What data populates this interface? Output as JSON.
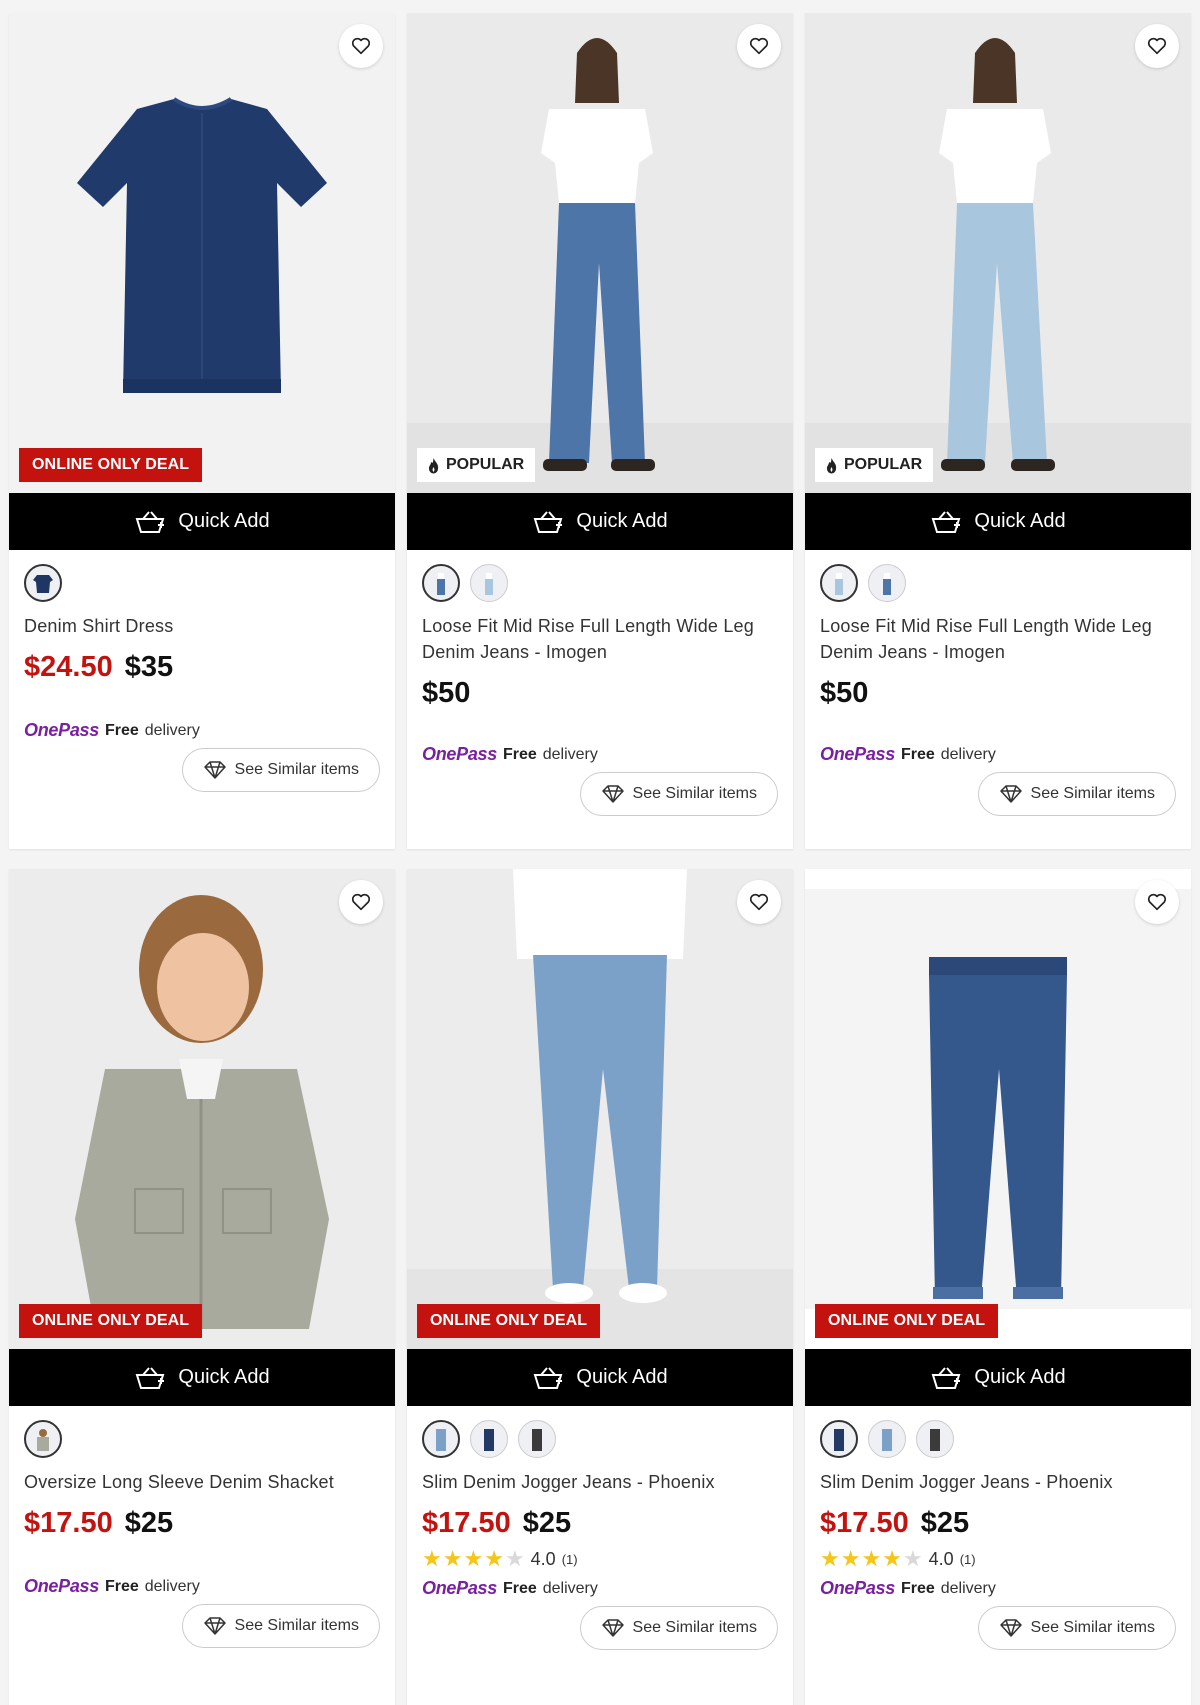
{
  "colors": {
    "accent_red": "#c4120f",
    "onepass_purple": "#7a1fa2",
    "star": "#f5c518",
    "quick_add_bg": "#000000"
  },
  "common": {
    "quick_add": "Quick Add",
    "see_similar": "See Similar items",
    "onepass_logo": "OnePass",
    "free": "Free",
    "delivery": "delivery"
  },
  "products": [
    {
      "name": "Denim Shirt Dress",
      "sale": "$24.50",
      "orig": "$35",
      "badge": "ONLINE ONLY DEAL",
      "badge_type": "deal",
      "swatches": 1,
      "image": "denim-dress"
    },
    {
      "name": "Loose Fit Mid Rise Full Length Wide Leg Denim Jeans - Imogen",
      "sale": "",
      "orig": "$50",
      "badge": "POPULAR",
      "badge_type": "popular",
      "swatches": 2,
      "image": "woman-mid-jeans"
    },
    {
      "name": "Loose Fit Mid Rise Full Length Wide Leg Denim Jeans - Imogen",
      "sale": "",
      "orig": "$50",
      "badge": "POPULAR",
      "badge_type": "popular",
      "swatches": 2,
      "image": "woman-light-jeans"
    },
    {
      "name": "Oversize Long Sleeve Denim Shacket",
      "sale": "$17.50",
      "orig": "$25",
      "badge": "ONLINE ONLY DEAL",
      "badge_type": "deal",
      "swatches": 1,
      "image": "child-shacket"
    },
    {
      "name": "Slim Denim Jogger Jeans - Phoenix",
      "sale": "$17.50",
      "orig": "$25",
      "badge": "ONLINE ONLY DEAL",
      "badge_type": "deal",
      "swatches": 3,
      "rating": "4.0",
      "rating_count": "(1)",
      "stars": 4,
      "image": "kid-jogger-model"
    },
    {
      "name": "Slim Denim Jogger Jeans - Phoenix",
      "sale": "$17.50",
      "orig": "$25",
      "badge": "ONLINE ONLY DEAL",
      "badge_type": "deal",
      "swatches": 3,
      "rating": "4.0",
      "rating_count": "(1)",
      "stars": 4,
      "image": "jogger-flat"
    }
  ]
}
